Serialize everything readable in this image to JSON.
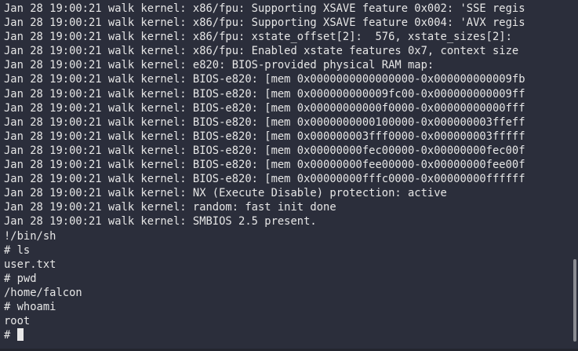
{
  "terminal": {
    "lines": [
      "Jan 28 19:00:21 walk kernel: x86/fpu: Supporting XSAVE feature 0x002: 'SSE regis",
      "Jan 28 19:00:21 walk kernel: x86/fpu: Supporting XSAVE feature 0x004: 'AVX regis",
      "Jan 28 19:00:21 walk kernel: x86/fpu: xstate_offset[2]:  576, xstate_sizes[2]:",
      "Jan 28 19:00:21 walk kernel: x86/fpu: Enabled xstate features 0x7, context size",
      "Jan 28 19:00:21 walk kernel: e820: BIOS-provided physical RAM map:",
      "Jan 28 19:00:21 walk kernel: BIOS-e820: [mem 0x0000000000000000-0x000000000009fb",
      "Jan 28 19:00:21 walk kernel: BIOS-e820: [mem 0x000000000009fc00-0x000000000009ff",
      "Jan 28 19:00:21 walk kernel: BIOS-e820: [mem 0x00000000000f0000-0x00000000000fff",
      "Jan 28 19:00:21 walk kernel: BIOS-e820: [mem 0x0000000000100000-0x000000003ffeff",
      "Jan 28 19:00:21 walk kernel: BIOS-e820: [mem 0x000000003fff0000-0x000000003fffff",
      "Jan 28 19:00:21 walk kernel: BIOS-e820: [mem 0x00000000fec00000-0x00000000fec00f",
      "Jan 28 19:00:21 walk kernel: BIOS-e820: [mem 0x00000000fee00000-0x00000000fee00f",
      "Jan 28 19:00:21 walk kernel: BIOS-e820: [mem 0x00000000fffc0000-0x00000000ffffff",
      "Jan 28 19:00:21 walk kernel: NX (Execute Disable) protection: active",
      "Jan 28 19:00:21 walk kernel: random: fast init done",
      "Jan 28 19:00:21 walk kernel: SMBIOS 2.5 present.",
      "!/bin/sh",
      "# ls",
      "user.txt",
      "# pwd",
      "/home/falcon",
      "# whoami",
      "root"
    ],
    "prompt": "# "
  },
  "colors": {
    "background": "#2b2e3b",
    "text": "#e6e6e6",
    "cursor": "#e8e8e8",
    "scrollbar": "#8a8c93"
  }
}
